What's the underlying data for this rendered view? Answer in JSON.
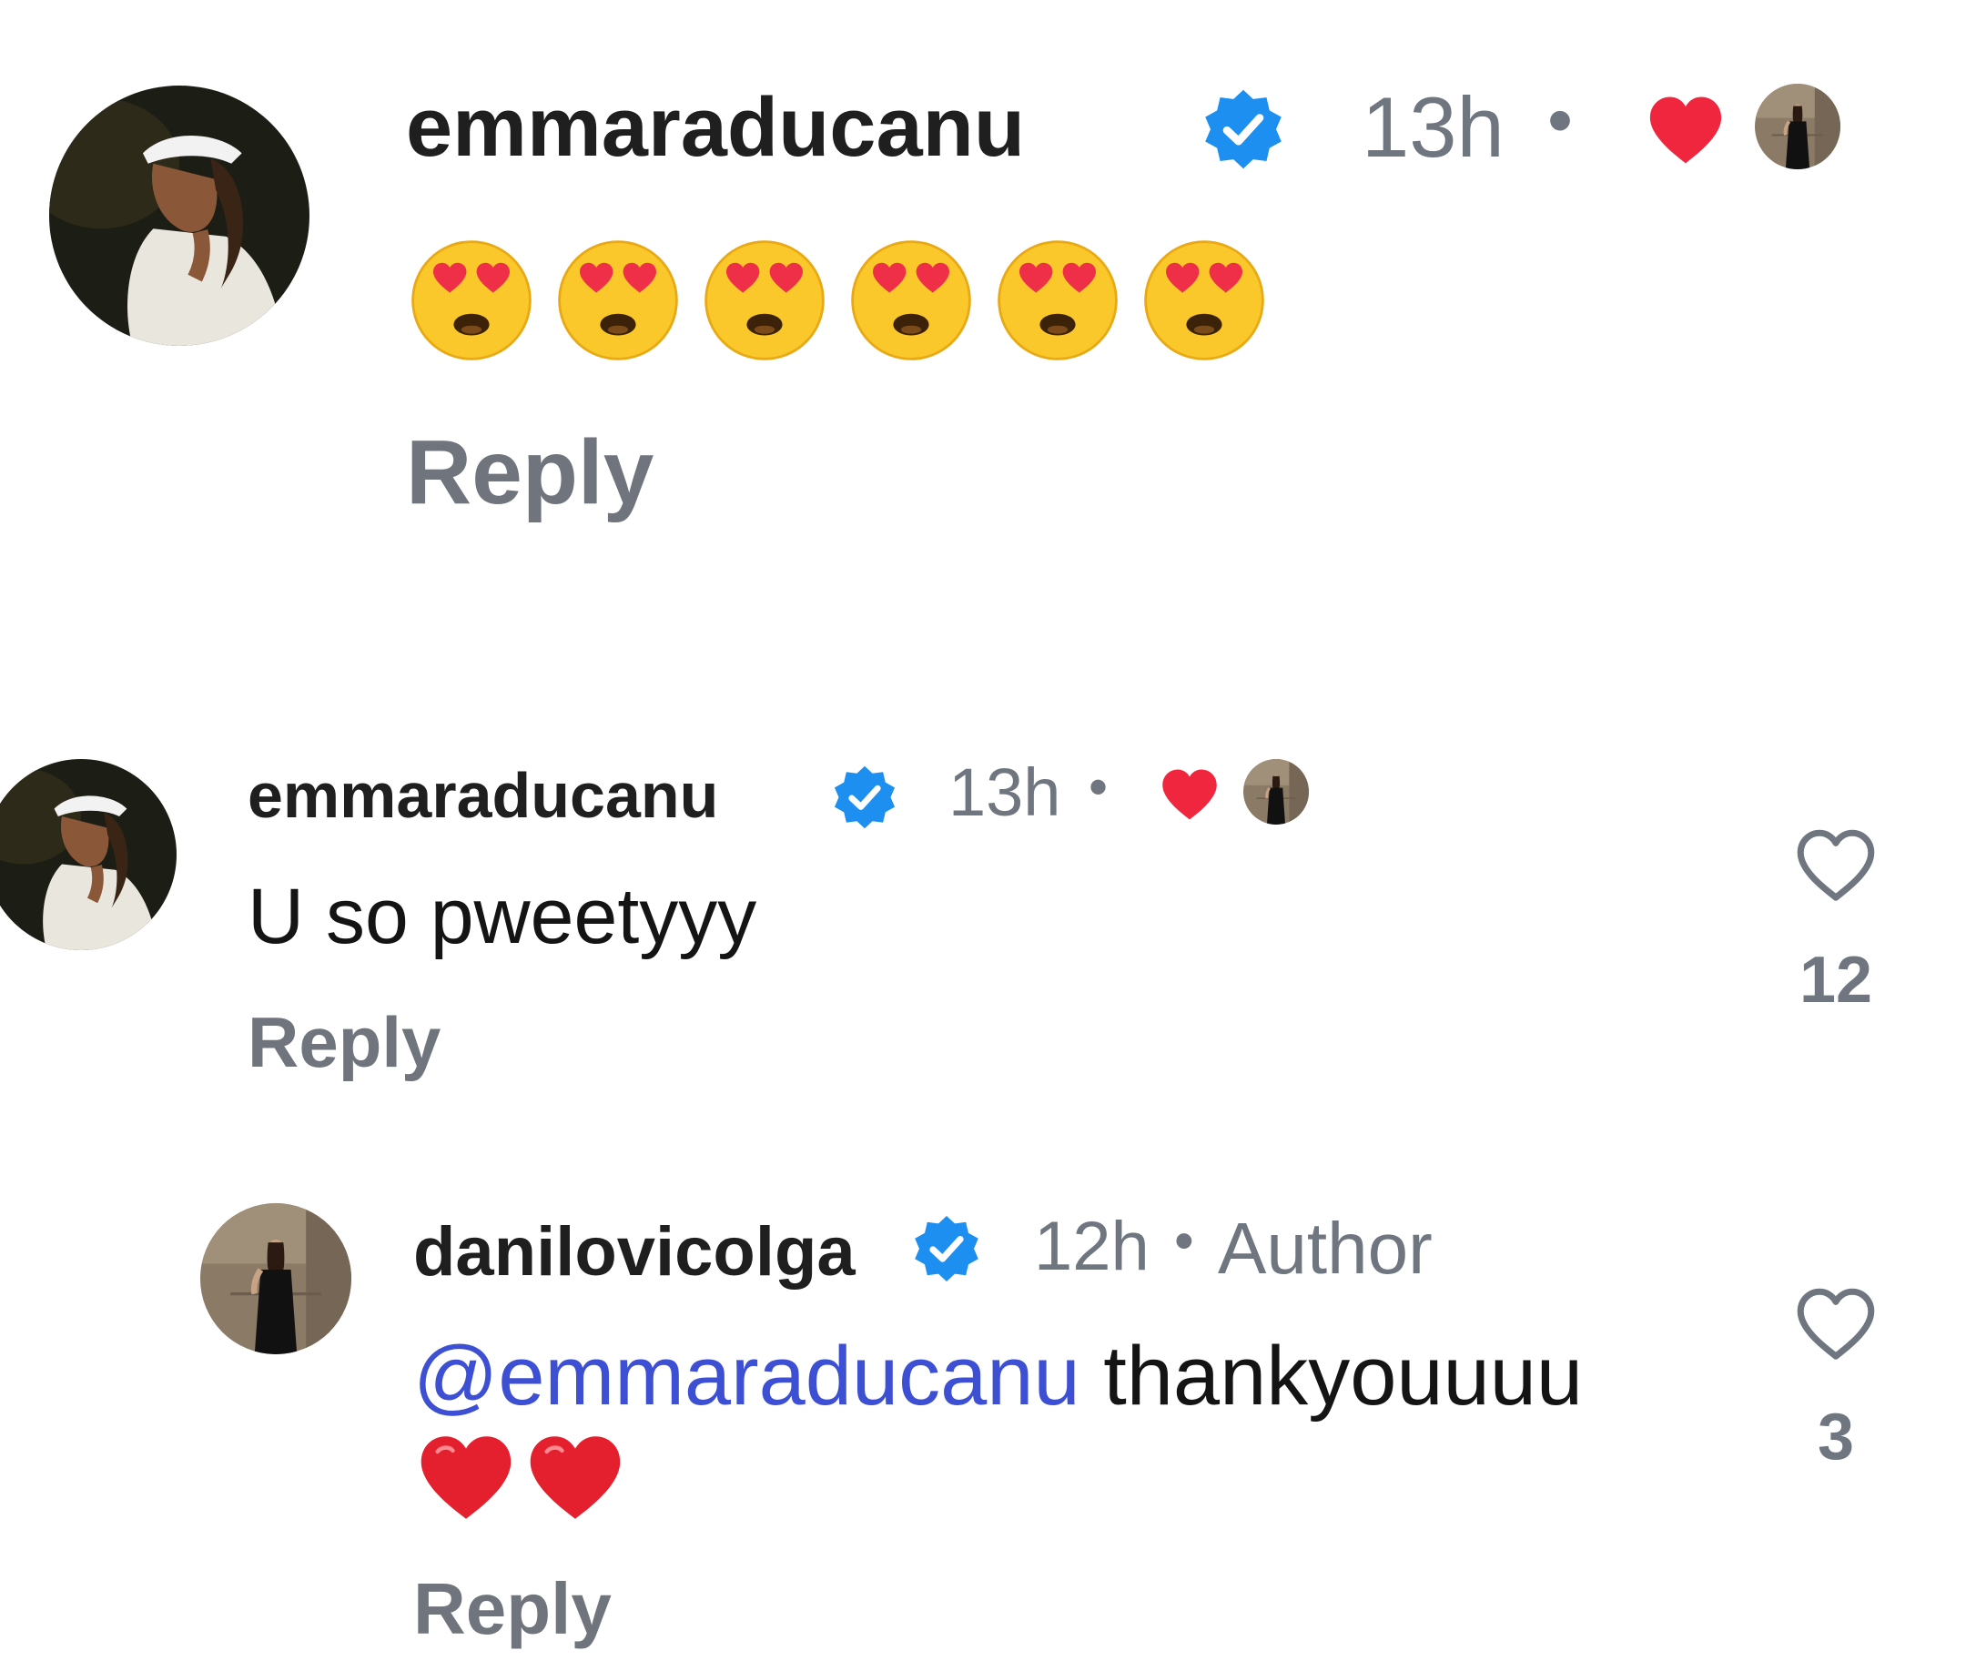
{
  "comments": [
    {
      "username": "emmaraducanu",
      "verified": true,
      "time": "13h",
      "separator": "•",
      "liked_by_author": true,
      "text": "😍😍😍😍😍😍",
      "emoji_count": 6,
      "reply_label": "Reply"
    },
    {
      "username": "emmaraducanu",
      "verified": true,
      "time": "13h",
      "separator": "•",
      "liked_by_author": true,
      "text": "U so pweetyyy",
      "reply_label": "Reply",
      "like_count": "12"
    },
    {
      "username": "danilovicolga",
      "verified": true,
      "time": "12h",
      "separator": "•",
      "badge": "Author",
      "mention": "@emmaraducanu",
      "text": "thankyouuuu",
      "hearts": "❤️❤️",
      "reply_label": "Reply",
      "like_count": "3"
    }
  ],
  "colors": {
    "verified_blue": "#1d8ff0",
    "heart_red": "#f0263f",
    "mention_blue": "#3d4fd3",
    "meta_gray": "#6f7680"
  },
  "icons": [
    "verified-badge-icon",
    "heart-icon",
    "author-avatar-mini",
    "like-outline-icon",
    "smiling-face-heart-eyes-emoji",
    "red-heart-emoji"
  ]
}
